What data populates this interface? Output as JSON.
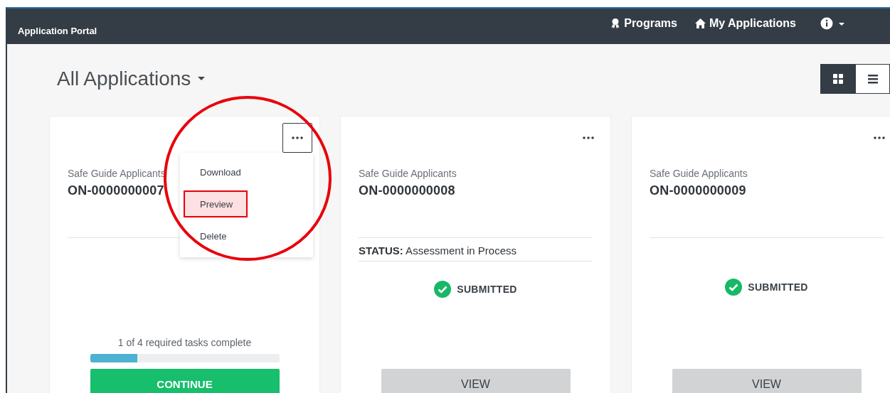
{
  "navbar": {
    "title": "Application Portal",
    "links": [
      {
        "label": "Programs",
        "kind": "award"
      },
      {
        "label": "My Applications",
        "kind": "home"
      }
    ]
  },
  "header": {
    "title": "All Applications",
    "view_toggle": [
      {
        "kind": "grid",
        "selected": true
      },
      {
        "kind": "list",
        "selected": false
      }
    ]
  },
  "cards": [
    {
      "program": "Safe Guide Applicants",
      "id": "ON-0000000007",
      "menu_open": true,
      "menu": [
        {
          "label": "Download",
          "highlighted": false
        },
        {
          "label": "Preview",
          "highlighted": true
        },
        {
          "label": "Delete",
          "highlighted": false
        }
      ],
      "progress": {
        "text": "1 of 4 required tasks complete",
        "level": 0.25
      },
      "button": {
        "label": "CONTINUE",
        "kind": "primary"
      }
    },
    {
      "program": "Safe Guide Applicants",
      "id": "ON-0000000008",
      "menu_open": false,
      "status": "**STATUS:** Assessment in Process",
      "badge": "SUBMITTED",
      "button": {
        "label": "VIEW",
        "kind": "secondary"
      }
    },
    {
      "program": "Safe Guide Applicants",
      "id": "ON-0000000009",
      "menu_open": false,
      "badge": "SUBMITTED",
      "button": {
        "label": "VIEW",
        "kind": "secondary"
      }
    }
  ]
}
